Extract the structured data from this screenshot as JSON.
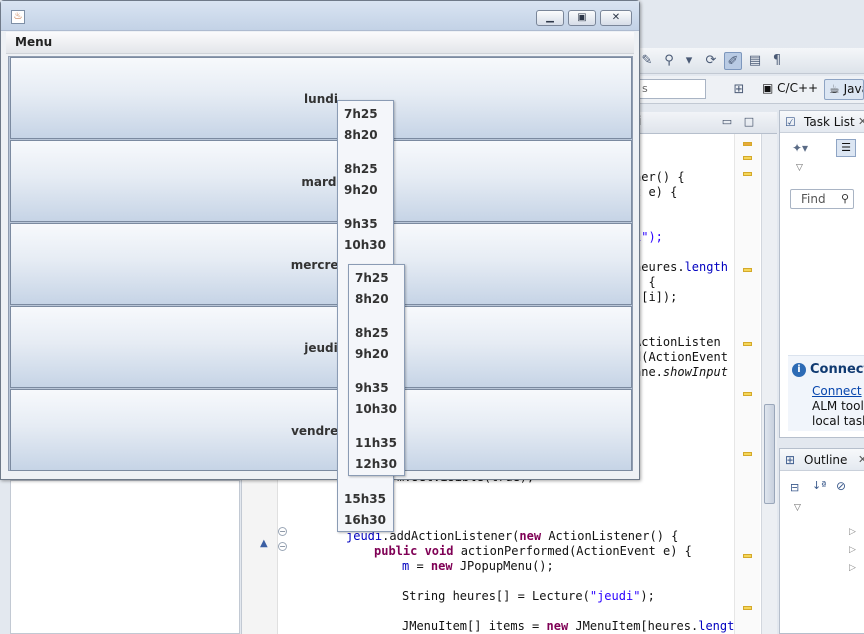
{
  "swing_window": {
    "menu_label": "Menu",
    "days": [
      "lundi",
      "mardi",
      "mercredi",
      "jeudi",
      "vendredi"
    ]
  },
  "popup_lundi": {
    "items": [
      "7h25",
      "8h20",
      "8h25",
      "9h20",
      "9h35",
      "10h30",
      "",
      "",
      "",
      "",
      "",
      "",
      "15h35",
      "16h30"
    ]
  },
  "popup_mercredi": {
    "items": [
      "7h25",
      "8h20",
      "8h25",
      "9h20",
      "9h35",
      "10h30",
      "11h35",
      "12h30"
    ]
  },
  "eclipse": {
    "search_placeholder": "s",
    "perspectives": [
      "C/C++",
      "Java"
    ],
    "task_list": {
      "title": "Task List",
      "find_placeholder": "Find",
      "connect_title": "Connect",
      "connect_link": "Connect",
      "connect_link_tail": " t",
      "connect_text_2": "ALM tools",
      "connect_text_3": "local task."
    },
    "outline_title": "Outline",
    "code": {
      "l1": "ner() {",
      "l2": "t e) {",
      "l3a": "i\");",
      "l4a": "heures.",
      "l4b": "length",
      "l5": ") {",
      "l6": "s[i]);",
      "l7": "ActionListen",
      "l8": "d(ActionEvent",
      "l9a": "ane.",
      "l9b": "showInput",
      "l10": "m.setVisible(true);",
      "l11a": "jeudi",
      "l11b": ".addActionListener(",
      "l11c": "new",
      "l11d": " ActionListener() {",
      "l12a": "public void",
      "l12b": " actionPerformed(ActionEvent e) {",
      "l13a": "m",
      "l13b": " = ",
      "l13c": "new",
      "l13d": " JPopupMenu();",
      "l14a": "String heures[] = Lecture(",
      "l14b": "\"jeudi\"",
      "l14c": ");",
      "l15a": "JMenuItem[] items = ",
      "l15b": "new",
      "l15c": " JMenuItem[heures.",
      "l15d": "length"
    }
  }
}
